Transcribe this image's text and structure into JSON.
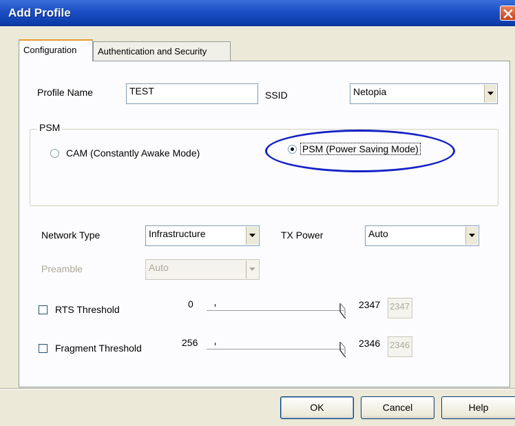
{
  "window": {
    "title": "Add Profile"
  },
  "tabs": [
    {
      "label": "Configuration",
      "active": true
    },
    {
      "label": "Authentication and Security",
      "active": false
    }
  ],
  "profile": {
    "name_label": "Profile Name",
    "name_value": "TEST",
    "ssid_label": "SSID",
    "ssid_value": "Netopia"
  },
  "psm": {
    "group_label": "PSM",
    "options": [
      {
        "label": "CAM (Constantly Awake Mode)",
        "selected": false
      },
      {
        "label": "PSM (Power Saving Mode)",
        "selected": true
      }
    ],
    "highlight_color": "#1421c4"
  },
  "network": {
    "type_label": "Network Type",
    "type_value": "Infrastructure",
    "tx_power_label": "TX Power",
    "tx_power_value": "Auto",
    "preamble_label": "Preamble",
    "preamble_value": "Auto",
    "preamble_enabled": false
  },
  "rts": {
    "label": "RTS Threshold",
    "checked": false,
    "min": "0",
    "max": "2347",
    "value": "2347"
  },
  "fragment": {
    "label": "Fragment Threshold",
    "checked": false,
    "min": "256",
    "max": "2346",
    "value": "2346"
  },
  "buttons": {
    "ok": "OK",
    "cancel": "Cancel",
    "help": "Help"
  },
  "icons": {
    "close": "close-icon",
    "dropdown": "chevron-down-icon"
  }
}
